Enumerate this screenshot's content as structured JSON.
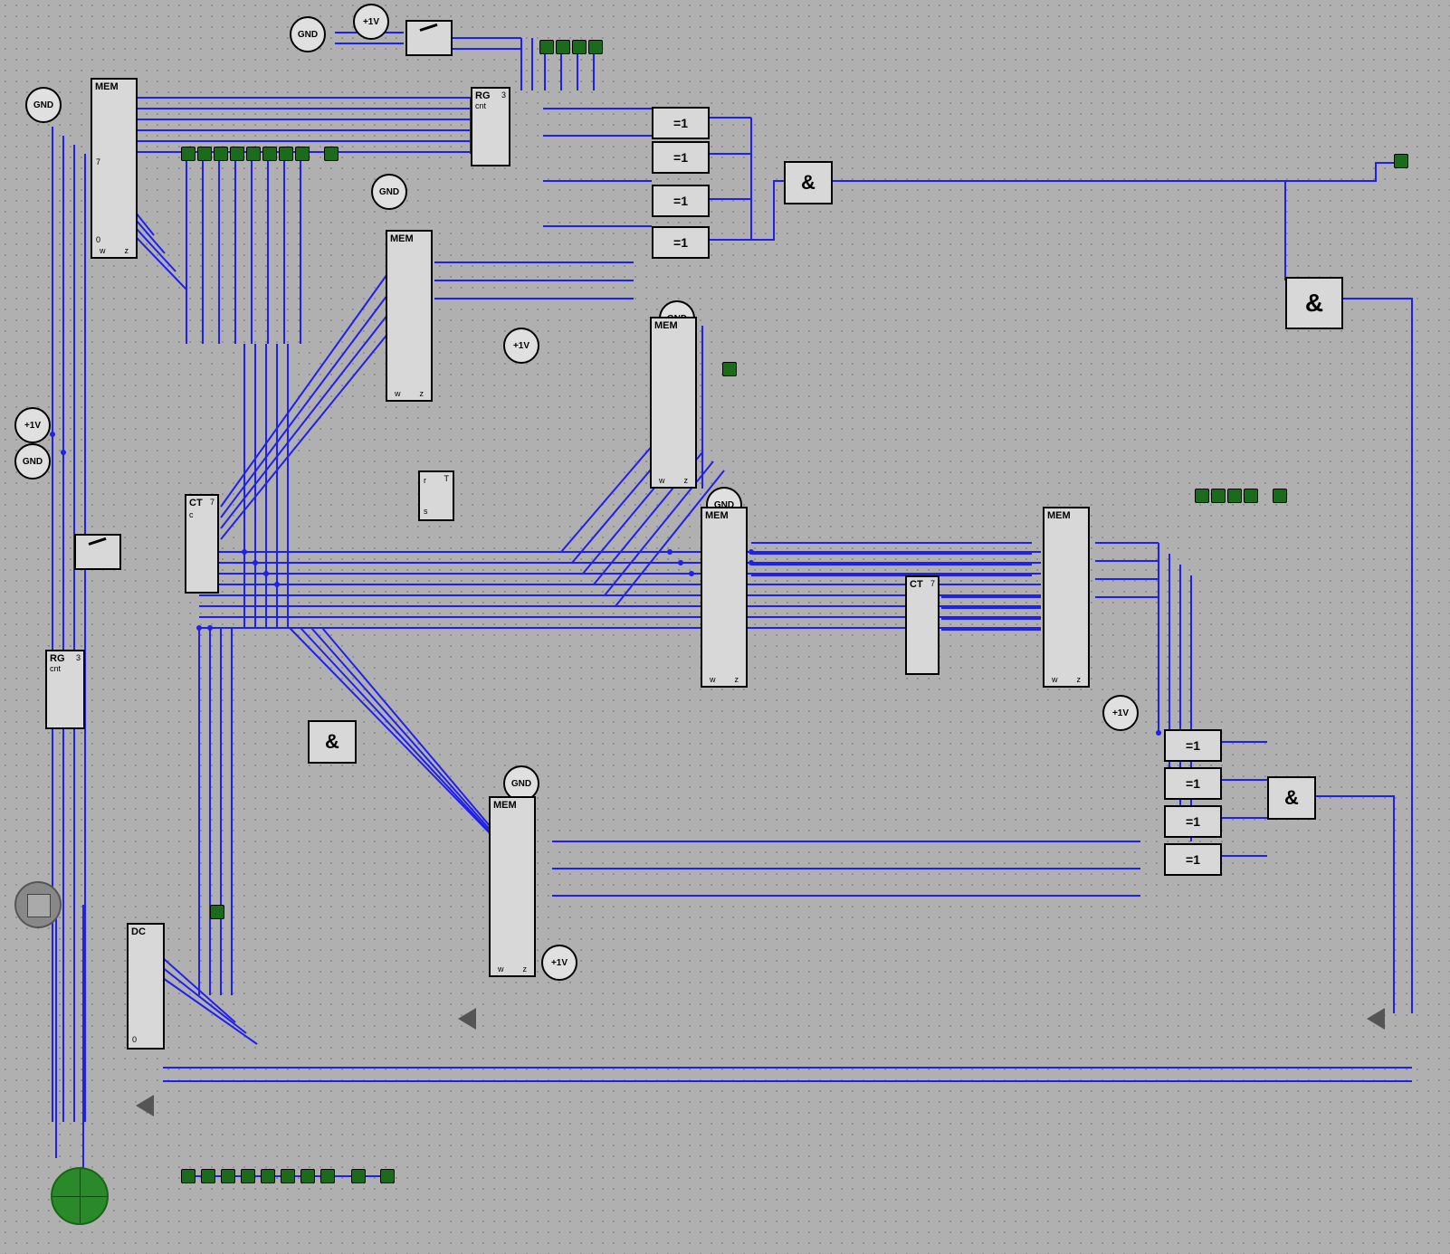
{
  "power": {
    "gnd": "GND",
    "v1": "+1V"
  },
  "blocks": {
    "mem": "MEM",
    "rg": "RG",
    "cnt": "cnt",
    "ct": "CT",
    "dc": "DC",
    "ff": "T",
    "pins": {
      "w": "w",
      "z": "z",
      "seven": "7",
      "zero": "0",
      "three": "3",
      "r": "r",
      "s": "s",
      "c": "c"
    }
  },
  "gates": {
    "and": "&",
    "xor": "=1"
  }
}
